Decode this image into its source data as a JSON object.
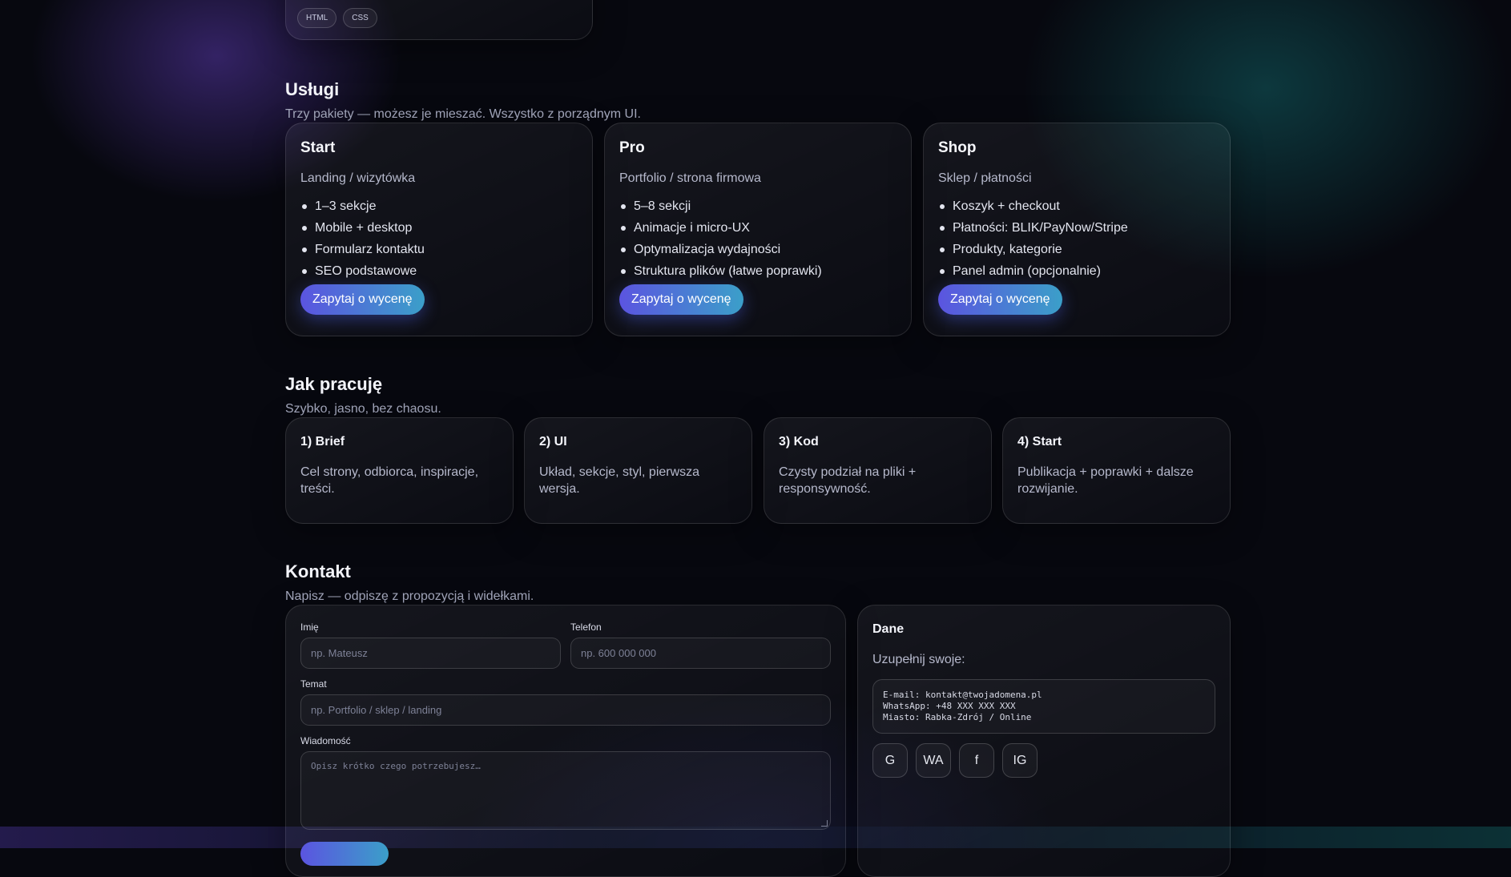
{
  "top_card": {
    "tags": [
      "HTML",
      "CSS"
    ]
  },
  "services": {
    "title": "Usługi",
    "subtitle": "Trzy pakiety — możesz je mieszać. Wszystko z porządnym UI.",
    "packages": [
      {
        "name": "Start",
        "desc": "Landing / wizytówka",
        "features": [
          "1–3 sekcje",
          "Mobile + desktop",
          "Formularz kontaktu",
          "SEO podstawowe"
        ],
        "cta": "Zapytaj o wycenę"
      },
      {
        "name": "Pro",
        "desc": "Portfolio / strona firmowa",
        "features": [
          "5–8 sekcji",
          "Animacje i micro-UX",
          "Optymalizacja wydajności",
          "Struktura plików (łatwe poprawki)"
        ],
        "cta": "Zapytaj o wycenę"
      },
      {
        "name": "Shop",
        "desc": "Sklep / płatności",
        "features": [
          "Koszyk + checkout",
          "Płatności: BLIK/PayNow/Stripe",
          "Produkty, kategorie",
          "Panel admin (opcjonalnie)"
        ],
        "cta": "Zapytaj o wycenę"
      }
    ]
  },
  "process": {
    "title": "Jak pracuję",
    "subtitle": "Szybko, jasno, bez chaosu.",
    "steps": [
      {
        "title": "1) Brief",
        "text": "Cel strony, odbiorca, inspiracje, treści."
      },
      {
        "title": "2) UI",
        "text": "Układ, sekcje, styl, pierwsza wersja."
      },
      {
        "title": "3) Kod",
        "text": "Czysty podział na pliki + responsywność."
      },
      {
        "title": "4) Start",
        "text": "Publikacja + poprawki + dalsze rozwijanie."
      }
    ]
  },
  "contact": {
    "title": "Kontakt",
    "subtitle": "Napisz — odpiszę z propozycją i widełkami.",
    "form": {
      "name_label": "Imię",
      "name_placeholder": "np. Mateusz",
      "phone_label": "Telefon",
      "phone_placeholder": "np. 600 000 000",
      "subject_label": "Temat",
      "subject_placeholder": "np. Portfolio / sklep / landing",
      "message_label": "Wiadomość",
      "message_placeholder": "Opisz krótko czego potrzebujesz…"
    },
    "data_card": {
      "title": "Dane",
      "hint": "Uzupełnij swoje:",
      "lines": [
        "E-mail: kontakt@twojadomena.pl",
        "WhatsApp: +48 XXX XXX XXX",
        "Miasto: Rabka-Zdrój / Online"
      ],
      "socials": [
        "G",
        "WA",
        "f",
        "IG"
      ]
    }
  }
}
